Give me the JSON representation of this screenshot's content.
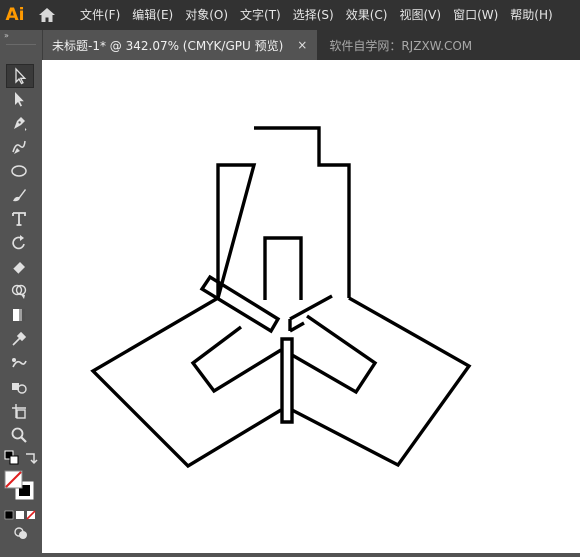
{
  "app": {
    "logo_text": "Ai",
    "home_icon": "home-icon"
  },
  "menu": [
    {
      "label": "文件(F)"
    },
    {
      "label": "编辑(E)"
    },
    {
      "label": "对象(O)"
    },
    {
      "label": "文字(T)"
    },
    {
      "label": "选择(S)"
    },
    {
      "label": "效果(C)"
    },
    {
      "label": "视图(V)"
    },
    {
      "label": "窗口(W)"
    },
    {
      "label": "帮助(H)"
    }
  ],
  "tabs": {
    "active": {
      "title": "未标题-1* @ 342.07% (CMYK/GPU 预览)",
      "close": "×"
    },
    "inactive": {
      "title": "软件自学网：RJZXW.COM"
    }
  },
  "toolbar": {
    "collapse": "»",
    "tools": [
      "selection-tool-icon",
      "direct-selection-tool-icon",
      "pen-tool-icon",
      "curvature-tool-icon",
      "ellipse-tool-icon",
      "paintbrush-tool-icon",
      "type-tool-icon",
      "rotate-tool-icon",
      "eraser-tool-icon",
      "shape-builder-tool-icon",
      "gradient-tool-icon",
      "eyedropper-tool-icon",
      "blend-tool-icon",
      "symbol-sprayer-tool-icon",
      "artboard-tool-icon",
      "zoom-tool-icon"
    ]
  },
  "colors": {
    "menubar": "#323232",
    "workspace": "#535353",
    "canvas": "#ffffff",
    "logo": "#ff9a00",
    "stroke": "#000000"
  }
}
